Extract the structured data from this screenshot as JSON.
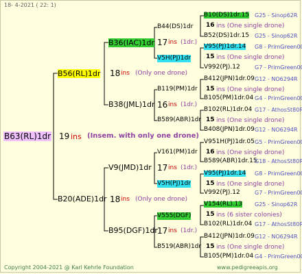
{
  "header": "18-  4-2021 (  22:  1)",
  "root": {
    "name": "B63(RL)1dr",
    "ins": "19",
    "ins_word": "ins",
    "note": "(Insem. with only one drone)"
  },
  "g1": [
    {
      "name": "B56(RL)1dr",
      "ins": "18",
      "note": "(Only one drone)"
    },
    {
      "name": "B20(ADE)1dr",
      "ins": "18",
      "note": "(Only one drone)"
    }
  ],
  "g2": [
    {
      "name": "B36(IAC)1dr",
      "ins": "17",
      "note": "(1dr.)"
    },
    {
      "name": "B38(JML)1dr",
      "ins": "16",
      "note": "(1dr.)"
    },
    {
      "name": "V9(JMD)1dr",
      "ins": "17",
      "note": "(1dr.)"
    },
    {
      "name": "B95(DGF)1dr",
      "ins": "17",
      "note": "(1dr.)"
    }
  ],
  "g3": [
    {
      "name": "B44(DS)1dr",
      "ins": "16",
      "note": "(1dr.)"
    },
    {
      "name": "V5H(PJ)1dr",
      "ins": "15",
      "note": "(1dr.)"
    },
    {
      "name": "B119(PM)1dr",
      "ins": "15",
      "note": "(1dr.)"
    },
    {
      "name": "B589(ABR)1dr",
      "ins": "15",
      "note": "(1dr.)"
    },
    {
      "name": "V161(PM)1dr",
      "ins": "16",
      "note": "(1dr.)"
    },
    {
      "name": "V5H(PJ)1dr",
      "ins": "15",
      "note": "(1dr.)"
    },
    {
      "name": "V555(DGF)",
      "ins": "15",
      "note": "(1dr.)"
    },
    {
      "name": "B519(ABR)1dr",
      "ins": "15",
      "note": "(1dr.)"
    }
  ],
  "g4": [
    {
      "name": "B10(DS)1dr.15",
      "src": "G25 - Sinop62R"
    },
    {
      "ins": "16",
      "note": "ins (One single drone)"
    },
    {
      "name": "B52(DS)1dr.15",
      "src": "G25 - Sinop62R"
    },
    {
      "name": "V95(PJ)1dr.14",
      "src": "G8 - PrimGreen00"
    },
    {
      "ins": "15",
      "note": "ins (One single drone)"
    },
    {
      "name": "V992(PJ).12",
      "src": "G7 - PrimGreen00"
    },
    {
      "name": "B412(JPN)1dr.09",
      "src": "G12 - NO6294R"
    },
    {
      "ins": "15",
      "note": "ins (One single drone)"
    },
    {
      "name": "B105(PM)1dr.04",
      "src": "G4 - PrimGreen00"
    },
    {
      "name": "B102(RL)1dr.04",
      "src": "G17 - AthosSt80R"
    },
    {
      "ins": "15",
      "note": "ins (One single drone)"
    },
    {
      "name": "B408(JPN)1dr.09",
      "src": "G12 - NO6294R"
    },
    {
      "name": "V951H(PJ)1dr.05",
      "src": "G5 - PrimGreen00"
    },
    {
      "ins": "16",
      "note": "ins (One single drone)"
    },
    {
      "name": "B589(ABR)1dr.15",
      "src": "G18 - AthosSt80R"
    },
    {
      "name": "V95(PJ)1dr.14",
      "src": "G8 - PrimGreen00"
    },
    {
      "ins": "15",
      "note": "ins (One single drone)"
    },
    {
      "name": "V992(PJ).12",
      "src": "G7 - PrimGreen00"
    },
    {
      "name": "V154(RL).13",
      "src": "G25 - Sinop62R"
    },
    {
      "ins": "15",
      "note": "ins (6 sister colonies)"
    },
    {
      "name": "B102(RL)1dr.04",
      "src": "G17 - AthosSt80R"
    },
    {
      "name": "B412(JPN)1dr.09",
      "src": "G12 - NO6294R"
    },
    {
      "ins": "15",
      "note": "ins (One single drone)"
    },
    {
      "name": "B105(PM)1dr.04",
      "src": "G4 - PrimGreen00"
    }
  ],
  "footer_left": "Copyright 2004-2021 @ Karl Kehrle Foundation",
  "footer_right": "www.pedigreeapis.org"
}
